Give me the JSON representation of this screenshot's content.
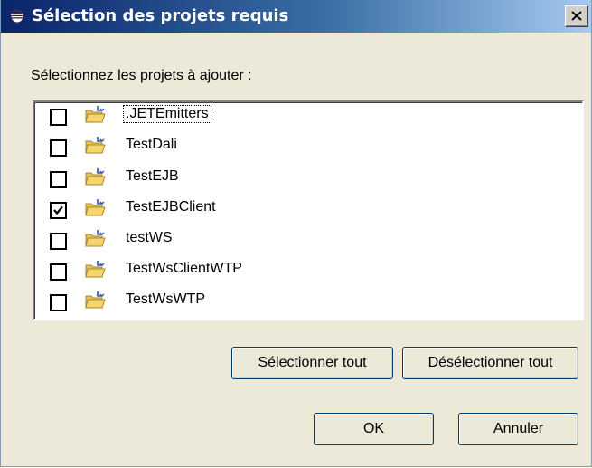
{
  "window": {
    "title": "Sélection des projets requis",
    "title_icon": "eclipse-icon",
    "close_icon": "close-icon"
  },
  "prompt": "Sélectionnez les projets à ajouter :",
  "projects": [
    {
      "name": ".JETEmitters",
      "checked": false,
      "focused": true
    },
    {
      "name": "TestDali",
      "checked": false,
      "focused": false
    },
    {
      "name": "TestEJB",
      "checked": false,
      "focused": false
    },
    {
      "name": "TestEJBClient",
      "checked": true,
      "focused": false
    },
    {
      "name": "testWS",
      "checked": false,
      "focused": false
    },
    {
      "name": "TestWsClientWTP",
      "checked": false,
      "focused": false
    },
    {
      "name": "TestWsWTP",
      "checked": false,
      "focused": false
    }
  ],
  "buttons": {
    "select_all": {
      "label": "Sélectionner tout",
      "mnemonic_prefix": "S",
      "mnemonic": "é",
      "rest": "lectionner tout"
    },
    "deselect_all": {
      "label": "Désélectionner tout",
      "mnemonic_prefix": "",
      "mnemonic": "D",
      "rest": "ésélectionner tout"
    },
    "ok": "OK",
    "cancel": "Annuler"
  },
  "colors": {
    "titlebar_start": "#0a246a",
    "titlebar_end": "#a6caf0",
    "dialog_bg": "#ece9d8",
    "folder": "#f6d56e"
  }
}
